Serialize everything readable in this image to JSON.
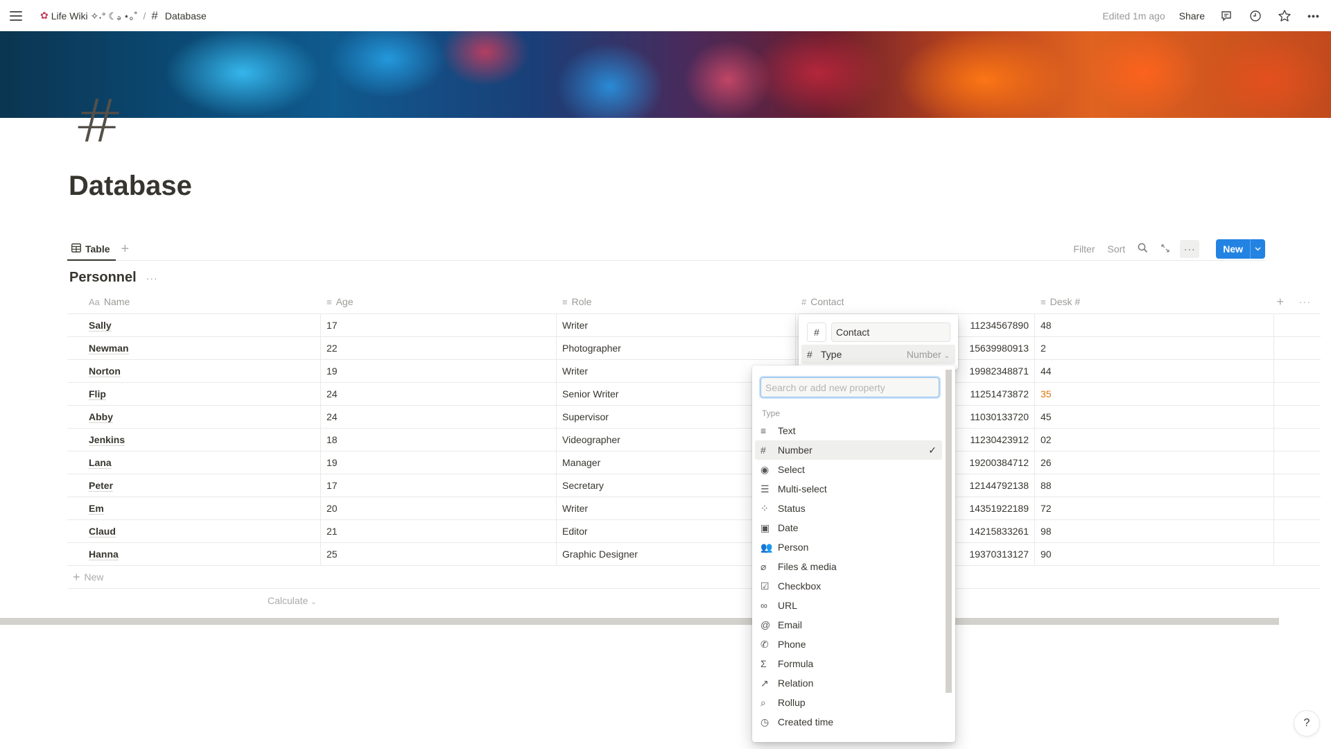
{
  "topbar": {
    "workspace_icon": "flower-icon",
    "workspace": "Life Wiki ✧˖° ☾ₔ ⋆｡˚",
    "separator": "/",
    "page_icon": "#",
    "page": "Database",
    "edited": "Edited 1m ago",
    "share": "Share",
    "icons": [
      "comment-icon",
      "history-clock-icon",
      "star-icon",
      "more-icon"
    ]
  },
  "page": {
    "icon": "#",
    "title": "Database"
  },
  "views": {
    "tabs": [
      {
        "label": "Table",
        "icon": "table-icon",
        "active": true
      }
    ],
    "add_view": "+",
    "actions": {
      "filter": "Filter",
      "sort": "Sort",
      "more": "···",
      "new": "New"
    }
  },
  "database": {
    "title": "Personnel",
    "more": "···",
    "columns": [
      {
        "label": "Name",
        "icon": "Aa"
      },
      {
        "label": "Age",
        "icon": "≡"
      },
      {
        "label": "Role",
        "icon": "≡"
      },
      {
        "label": "Contact",
        "icon": "#"
      },
      {
        "label": "Desk #",
        "icon": "≡"
      }
    ],
    "rows": [
      {
        "name": "Sally",
        "age": "17",
        "role": "Writer",
        "contact": "11234567890",
        "desk": "48"
      },
      {
        "name": "Newman",
        "age": "22",
        "role": "Photographer",
        "contact": "15639980913",
        "desk": "2"
      },
      {
        "name": "Norton",
        "age": "19",
        "role": "Writer",
        "contact": "19982348871",
        "desk": "44"
      },
      {
        "name": "Flip",
        "age": "24",
        "role": "Senior Writer",
        "contact": "11251473872",
        "desk": "35"
      },
      {
        "name": "Abby",
        "age": "24",
        "role": "Supervisor",
        "contact": "11030133720",
        "desk": "45"
      },
      {
        "name": "Jenkins",
        "age": "18",
        "role": "Videographer",
        "contact": "11230423912",
        "desk": "02"
      },
      {
        "name": "Lana",
        "age": "19",
        "role": "Manager",
        "contact": "19200384712",
        "desk": "26"
      },
      {
        "name": "Peter",
        "age": "17",
        "role": "Secretary",
        "contact": "12144792138",
        "desk": "88"
      },
      {
        "name": "Em",
        "age": "20",
        "role": "Writer",
        "contact": "14351922189",
        "desk": "72"
      },
      {
        "name": "Claud",
        "age": "21",
        "role": "Editor",
        "contact": "14215833261",
        "desk": "98"
      },
      {
        "name": "Hanna",
        "age": "25",
        "role": "Graphic Designer",
        "contact": "19370313127",
        "desk": "90"
      }
    ],
    "highlight_color": "#d9730d",
    "new_row": "New",
    "calculate": "Calculate"
  },
  "property_editor": {
    "icon": "#",
    "name_value": "Contact",
    "type_label": "Type",
    "type_value": "Number"
  },
  "type_menu": {
    "search_placeholder": "Search or add new property",
    "search_value": "",
    "section": "Type",
    "selected": "Number",
    "items": [
      {
        "label": "Text",
        "icon": "≡",
        "icon_name": "text-icon"
      },
      {
        "label": "Number",
        "icon": "#",
        "icon_name": "number-icon"
      },
      {
        "label": "Select",
        "icon": "◉",
        "icon_name": "select-icon"
      },
      {
        "label": "Multi-select",
        "icon": "☰",
        "icon_name": "multi-select-icon"
      },
      {
        "label": "Status",
        "icon": "⁘",
        "icon_name": "status-icon"
      },
      {
        "label": "Date",
        "icon": "▣",
        "icon_name": "calendar-icon"
      },
      {
        "label": "Person",
        "icon": "👥",
        "icon_name": "people-icon"
      },
      {
        "label": "Files & media",
        "icon": "⌀",
        "icon_name": "paperclip-icon"
      },
      {
        "label": "Checkbox",
        "icon": "☑",
        "icon_name": "checkbox-icon"
      },
      {
        "label": "URL",
        "icon": "∞",
        "icon_name": "link-icon"
      },
      {
        "label": "Email",
        "icon": "@",
        "icon_name": "at-icon"
      },
      {
        "label": "Phone",
        "icon": "✆",
        "icon_name": "phone-icon"
      },
      {
        "label": "Formula",
        "icon": "Σ",
        "icon_name": "sigma-icon"
      },
      {
        "label": "Relation",
        "icon": "↗",
        "icon_name": "arrow-up-right-icon"
      },
      {
        "label": "Rollup",
        "icon": "⌕",
        "icon_name": "search-icon"
      },
      {
        "label": "Created time",
        "icon": "◷",
        "icon_name": "clock-icon"
      }
    ],
    "check": "✓"
  },
  "help": "?",
  "colors": {
    "accent": "#2383e2",
    "text": "#37352f",
    "muted": "#9b9a97"
  }
}
